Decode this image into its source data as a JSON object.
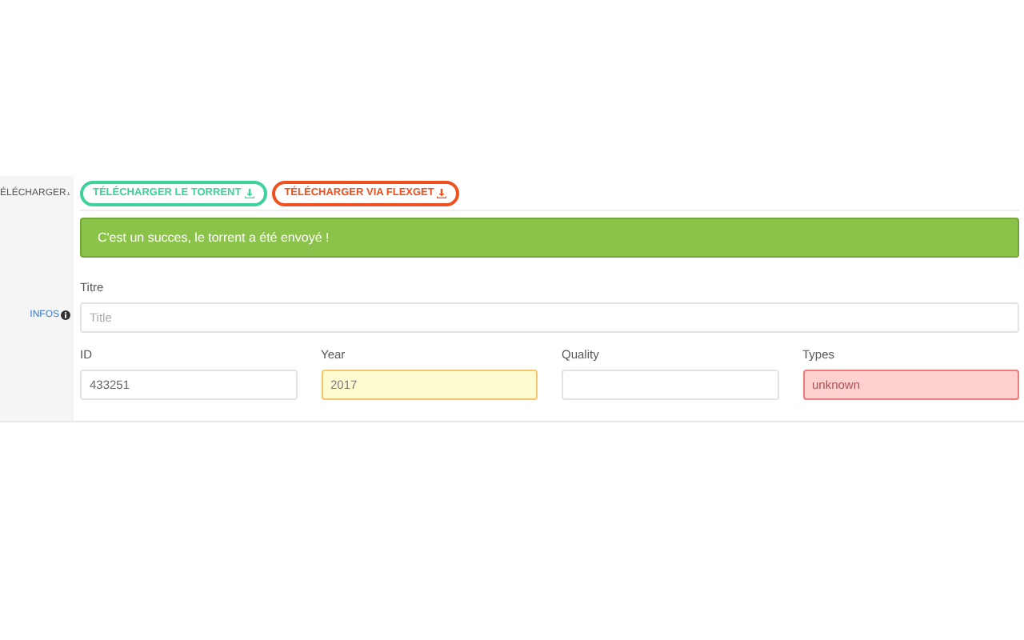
{
  "download": {
    "label": "ÉLÉCHARGER",
    "buttons": [
      {
        "label": "TÉLÉCHARGER LE TORRENT",
        "kind": "success"
      },
      {
        "label": "TÉLÉCHARGER VIA FLEXGET",
        "kind": "danger"
      }
    ]
  },
  "alert": {
    "text": "C'est un succes, le torrent a été envoyé !"
  },
  "infos": {
    "label": "INFOS",
    "title": {
      "label": "Titre",
      "placeholder": "Title"
    },
    "fields": [
      {
        "label": "ID",
        "value": "433251",
        "warning": false,
        "invalid": false
      },
      {
        "label": "Year",
        "value": "2017",
        "warning": true,
        "invalid": false
      },
      {
        "label": "Quality",
        "warning": false,
        "invalid": false
      },
      {
        "label": "Types",
        "value": "unknown",
        "warning": false,
        "invalid": true
      }
    ]
  }
}
